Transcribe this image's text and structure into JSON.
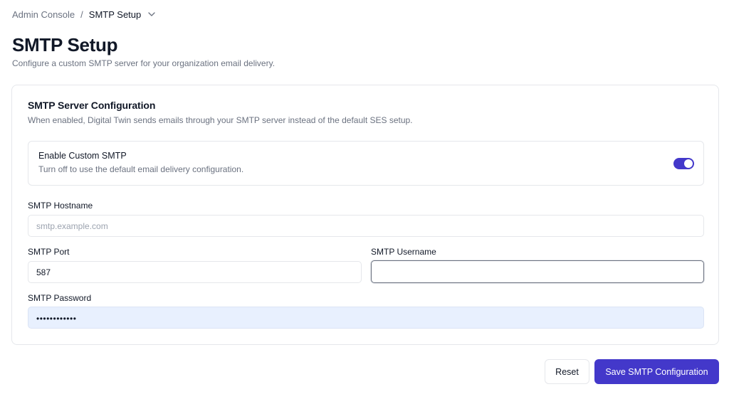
{
  "breadcrumb": {
    "root": "Admin Console",
    "separator": "/",
    "current": "SMTP Setup"
  },
  "header": {
    "title": "SMTP Setup",
    "subtitle": "Configure a custom SMTP server for your organization email delivery."
  },
  "card": {
    "title": "SMTP Server Configuration",
    "description": "When enabled, Digital Twin sends emails through your SMTP server instead of the default SES setup.",
    "toggle": {
      "title": "Enable Custom SMTP",
      "description": "Turn off to use the default email delivery configuration.",
      "enabled": true
    },
    "fields": {
      "hostname": {
        "label": "SMTP Hostname",
        "placeholder": "smtp.example.com",
        "value": ""
      },
      "port": {
        "label": "SMTP Port",
        "value": "587"
      },
      "username": {
        "label": "SMTP Username",
        "value": ""
      },
      "password": {
        "label": "SMTP Password",
        "masked_value": "••••••••••••"
      }
    }
  },
  "actions": {
    "reset_label": "Reset",
    "save_label": "Save SMTP Configuration"
  },
  "colors": {
    "accent": "#4338ca",
    "text_muted": "#6b7280",
    "border": "#e5e7eb",
    "autofill_bg": "#e8f0fe"
  },
  "icons": {
    "breadcrumb_dropdown": "chevron-down-icon"
  }
}
